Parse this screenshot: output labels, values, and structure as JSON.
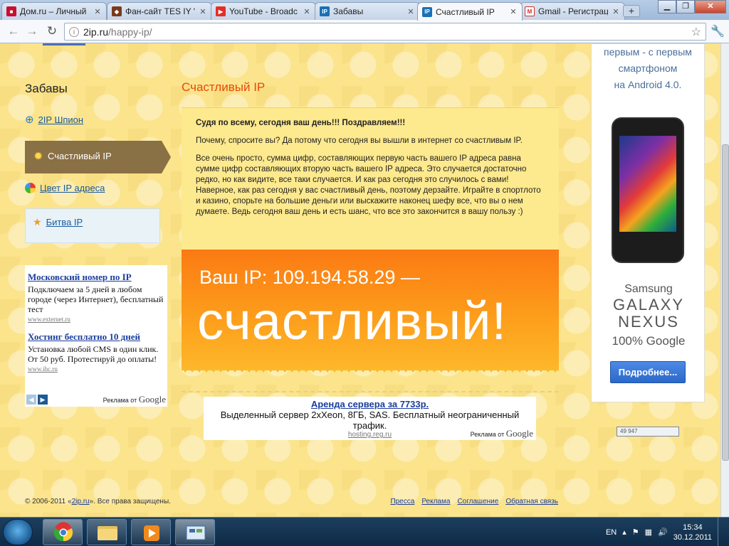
{
  "browser": {
    "tabs": [
      {
        "title": "Дом.ru – Личный",
        "icon": "domru-icon",
        "color": "#c8102e"
      },
      {
        "title": "Фан-сайт TES IY \"",
        "icon": "fansite-icon",
        "color": "#7a3a1a"
      },
      {
        "title": "YouTube - Broadc",
        "icon": "youtube-icon",
        "color": "#e52d27"
      },
      {
        "title": "Забавы",
        "icon": "ip-icon",
        "color": "#1a6fb5"
      },
      {
        "title": "Счастливый IP",
        "icon": "ip-icon",
        "color": "#1a6fb5"
      },
      {
        "title": "Gmail - Регистрац",
        "icon": "gmail-icon",
        "color": "#d93025"
      }
    ],
    "active_tab": 4,
    "url_host": "2ip.ru",
    "url_path": "/happy-ip/"
  },
  "sidebar": {
    "title": "Забавы",
    "items": [
      {
        "label": "2IP Шпион",
        "icon": "target-icon"
      },
      {
        "label": "Счастливый IP",
        "icon": "sun-icon"
      },
      {
        "label": "Цвет IP адреса",
        "icon": "color-ball-icon"
      },
      {
        "label": "Битва IP",
        "icon": "medal-icon"
      }
    ]
  },
  "ad_left": {
    "ads": [
      {
        "title": "Московский номер по IP",
        "body": "Подключаем за 5 дней в любом городе (через Интернет), бесплатный тест",
        "url": "www.externet.ru"
      },
      {
        "title": "Хостинг бесплатно 10 дней",
        "body": "Установка любой CMS в один клик. От 50 руб. Протестируй до оплаты!",
        "url": "www.ihc.ru"
      }
    ],
    "by_label": "Реклама от",
    "by_brand": "Google"
  },
  "main": {
    "title": "Счастливый IP",
    "greeting": "Судя по всему, сегодня ваш день!!! Поздравляем!!!",
    "para1": "Почему, спросите вы? Да потому что сегодня вы вышли в интернет со счастливым IP.",
    "para2": "Все очень просто, сумма цифр, составляющих первую часть вашего IP адреса равна сумме цифр составляющих вторую часть вашего IP адреса.  Это случается достаточно редко, но как видите, все таки случается. И как раз сегодня это случилось с вами! Наверное, как раз сегодня у вас счастливый день, поэтому дерзайте. Играйте в спортлото и казино, спорьте на большие деньги или выскажите наконец  шефу все, что вы о нем думаете. Ведь сегодня ваш день и есть шанс, что все это закончится в вашу пользу :)",
    "ip_line": "Ваш IP: 109.194.58.29 —",
    "ip_verdict": "счастливый!",
    "ip_value": "109.194.58.29"
  },
  "ad_mid": {
    "title": "Аренда сервера за 7733р.",
    "body": "Выделенный сервер 2xXeon, 8ГБ, SAS. Бесплатный неограниченный трафик.",
    "url": "hosting.reg.ru",
    "by_label": "Реклама от",
    "by_brand": "Google"
  },
  "ad_right": {
    "text_lines": [
      "первым - с первым",
      "смартфоном",
      "на Android 4.0."
    ],
    "brand": "Samsung",
    "model1": "GALAXY",
    "model2": "NEXUS",
    "tagline": "100% Google",
    "button": "Подробнее..."
  },
  "counter": "49 947",
  "footer": {
    "copyright_pre": "© 2006-2011 «",
    "copyright_link": "2ip.ru",
    "copyright_post": "». Все права защищены.",
    "links": [
      "Пресса",
      "Реклама",
      "Соглашение",
      "Обратная связь"
    ]
  },
  "taskbar": {
    "lang": "EN",
    "time": "15:34",
    "date": "30.12.2011"
  },
  "colors": {
    "accent": "#e64a0b",
    "banner": "#fb8a16",
    "page_bg": "#fbe48c",
    "sidebar_active": "#8a7045"
  }
}
